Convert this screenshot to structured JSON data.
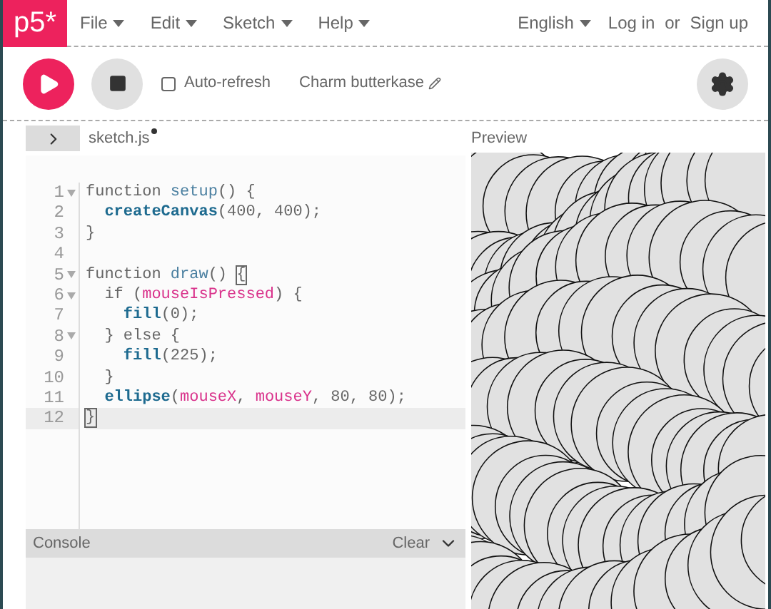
{
  "logo": "p5*",
  "menu": [
    {
      "label": "File"
    },
    {
      "label": "Edit"
    },
    {
      "label": "Sketch"
    },
    {
      "label": "Help"
    }
  ],
  "language": "English",
  "login": "Log in",
  "or": "or",
  "signup": "Sign up",
  "toolbar": {
    "auto_refresh": {
      "label": "Auto-refresh",
      "checked": false
    },
    "sketch_name": "Charm butterkase"
  },
  "editor": {
    "file_tab": {
      "label": "sketch.js",
      "unsaved": true
    },
    "lines": [
      {
        "number": "1",
        "fold": true,
        "active": false,
        "tokens": [
          {
            "kind": "plain",
            "text": "function "
          },
          {
            "kind": "def",
            "text": "setup"
          },
          {
            "kind": "plain",
            "text": "() {"
          }
        ]
      },
      {
        "number": "2",
        "fold": false,
        "active": false,
        "tokens": [
          {
            "kind": "builtin",
            "text": "  createCanvas"
          },
          {
            "kind": "plain",
            "text": "(400, 400);"
          }
        ]
      },
      {
        "number": "3",
        "fold": false,
        "active": false,
        "tokens": [
          {
            "kind": "plain",
            "text": "}"
          }
        ]
      },
      {
        "number": "4",
        "fold": false,
        "active": false
      },
      {
        "number": "5",
        "fold": true,
        "active": false,
        "tokens": [
          {
            "kind": "plain",
            "text": "function "
          },
          {
            "kind": "def",
            "text": "draw"
          },
          {
            "kind": "plain",
            "text": "() "
          },
          {
            "kind": "match",
            "text": "{"
          }
        ]
      },
      {
        "number": "6",
        "fold": true,
        "active": false,
        "tokens": [
          {
            "kind": "plain",
            "text": "  if ("
          },
          {
            "kind": "variable",
            "text": "mouseIsPressed"
          },
          {
            "kind": "plain",
            "text": ") {"
          }
        ]
      },
      {
        "number": "7",
        "fold": false,
        "active": false,
        "tokens": [
          {
            "kind": "builtin",
            "text": "    fill"
          },
          {
            "kind": "plain",
            "text": "(0);"
          }
        ]
      },
      {
        "number": "8",
        "fold": true,
        "active": false,
        "tokens": [
          {
            "kind": "plain",
            "text": "  } else {"
          }
        ]
      },
      {
        "number": "9",
        "fold": false,
        "active": false,
        "tokens": [
          {
            "kind": "builtin",
            "text": "    fill"
          },
          {
            "kind": "plain",
            "text": "(225);"
          }
        ]
      },
      {
        "number": "10",
        "fold": false,
        "active": false,
        "tokens": [
          {
            "kind": "plain",
            "text": "  }"
          }
        ]
      },
      {
        "number": "11",
        "fold": false,
        "active": false,
        "tokens": [
          {
            "kind": "builtin",
            "text": "  ellipse"
          },
          {
            "kind": "plain",
            "text": "("
          },
          {
            "kind": "variable",
            "text": "mouseX"
          },
          {
            "kind": "plain",
            "text": ", "
          },
          {
            "kind": "variable",
            "text": "mouseY"
          },
          {
            "kind": "plain",
            "text": ", 80, 80);"
          }
        ]
      },
      {
        "number": "12",
        "fold": false,
        "active": true,
        "tokens": [
          {
            "kind": "match",
            "text": "}"
          }
        ]
      }
    ]
  },
  "preview": {
    "title": "Preview"
  },
  "console": {
    "title": "Console",
    "clear": "Clear"
  }
}
